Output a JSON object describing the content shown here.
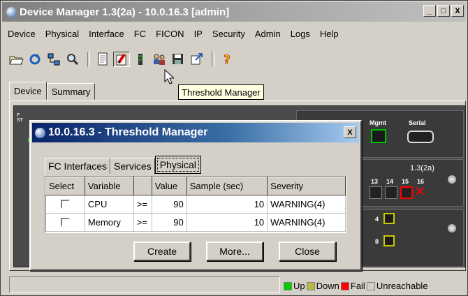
{
  "app": {
    "title": "Device Manager 1.3(2a) - 10.0.16.3 [admin]",
    "window_buttons": [
      "_",
      "□",
      "X"
    ]
  },
  "menu": [
    "Device",
    "Physical",
    "Interface",
    "FC",
    "FICON",
    "IP",
    "Security",
    "Admin",
    "Logs",
    "Help"
  ],
  "toolbar": {
    "icons": [
      "open-icon",
      "refresh-icon",
      "network-icon",
      "zoom-icon",
      "page-icon",
      "threshold-manager-icon",
      "bar-icon",
      "users-icon",
      "save-icon",
      "export-icon",
      "help-icon"
    ],
    "tooltip": "Threshold Manager"
  },
  "main_tabs": [
    "Device",
    "Summary"
  ],
  "device": {
    "mgmt_label": "Mgmt",
    "serial_label": "Serial",
    "version": "1.3(2a)",
    "port_numbers": [
      "13",
      "14",
      "15",
      "16"
    ],
    "module_ports": [
      "4",
      "8"
    ]
  },
  "legend": [
    {
      "label": "Up",
      "color": "#00cc00"
    },
    {
      "label": "Down",
      "color": "#b8b840"
    },
    {
      "label": "Fail",
      "color": "#ff0000"
    },
    {
      "label": "Unreachable",
      "color": "#d4d0c8"
    }
  ],
  "dialog": {
    "title": "10.0.16.3 - Threshold Manager",
    "close_glyph": "X",
    "tabs": [
      "FC Interfaces",
      "Services",
      "Physical"
    ],
    "active_tab": "Physical",
    "columns": [
      "Select",
      "Variable",
      "",
      "Value",
      "Sample (sec)",
      "Severity"
    ],
    "rows": [
      {
        "variable": "CPU",
        "op": ">=",
        "value": "90",
        "sample": "10",
        "severity": "WARNING(4)"
      },
      {
        "variable": "Memory",
        "op": ">=",
        "value": "90",
        "sample": "10",
        "severity": "WARNING(4)"
      }
    ],
    "buttons": {
      "create": "Create",
      "more": "More...",
      "close": "Close"
    }
  }
}
